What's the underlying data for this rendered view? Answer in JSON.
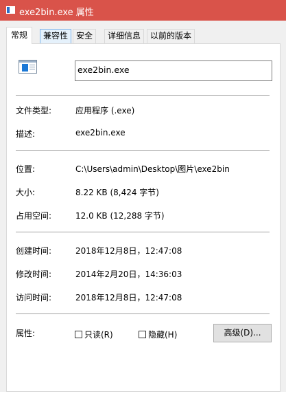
{
  "window": {
    "title": "exe2bin.exe 属性"
  },
  "tabs": [
    {
      "label": "常规",
      "active": true
    },
    {
      "label": "兼容性",
      "active": false
    },
    {
      "label": "安全",
      "active": false
    },
    {
      "label": "详细信息",
      "active": false
    },
    {
      "label": "以前的版本",
      "active": false
    }
  ],
  "file": {
    "icon": "exe-file-icon",
    "name": "exe2bin.exe"
  },
  "info": {
    "type_label": "文件类型:",
    "type_value": "应用程序 (.exe)",
    "desc_label": "描述:",
    "desc_value": "exe2bin.exe",
    "location_label": "位置:",
    "location_value": "C:\\Users\\admin\\Desktop\\图片\\exe2bin",
    "size_label": "大小:",
    "size_value": "8.22 KB (8,424 字节)",
    "disk_label": "占用空间:",
    "disk_value": "12.0 KB (12,288 字节)",
    "created_label": "创建时间:",
    "created_value": "2018年12月8日，12:47:08",
    "modified_label": "修改时间:",
    "modified_value": "2014年2月20日，14:36:03",
    "accessed_label": "访问时间:",
    "accessed_value": "2018年12月8日，12:47:08"
  },
  "attributes": {
    "label": "属性:",
    "readonly_label": "只读(R)",
    "readonly_checked": false,
    "hidden_label": "隐藏(H)",
    "hidden_checked": false,
    "advanced_label": "高级(D)..."
  },
  "colors": {
    "titlebar": "#d9534a",
    "tab_hover": "#e5f1fb",
    "tab_hover_border": "#7eb4ea"
  }
}
